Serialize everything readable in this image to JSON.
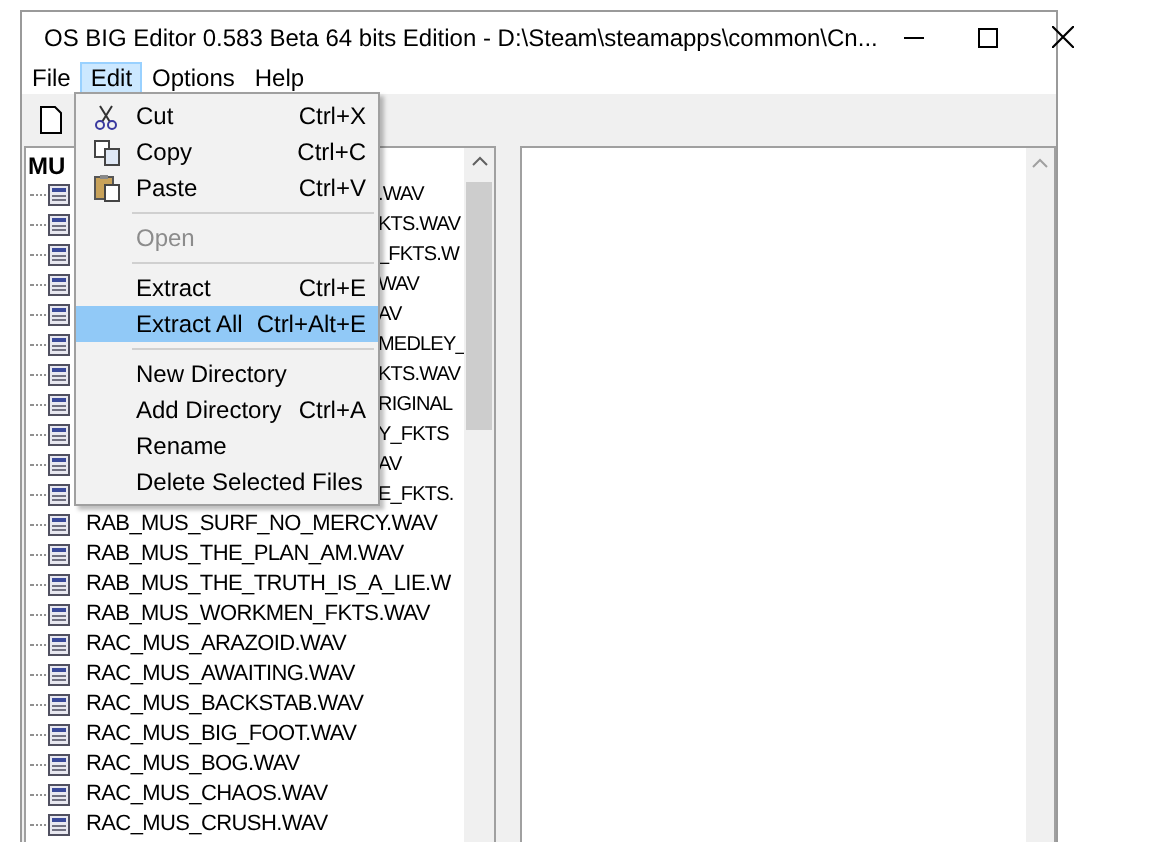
{
  "window": {
    "title": "OS BIG Editor 0.583 Beta 64 bits Edition - D:\\Steam\\steamapps\\common\\Cn..."
  },
  "menubar": [
    {
      "label": "File",
      "selected": false
    },
    {
      "label": "Edit",
      "selected": true
    },
    {
      "label": "Options",
      "selected": false
    },
    {
      "label": "Help",
      "selected": false
    }
  ],
  "edit_menu": [
    {
      "kind": "cut",
      "label": "Cut",
      "shortcut": "Ctrl+X",
      "disabled": false,
      "selected": false
    },
    {
      "kind": "copy",
      "label": "Copy",
      "shortcut": "Ctrl+C",
      "disabled": false,
      "selected": false
    },
    {
      "kind": "paste",
      "label": "Paste",
      "shortcut": "Ctrl+V",
      "disabled": false,
      "selected": false
    },
    {
      "kind": "separator"
    },
    {
      "kind": "command",
      "label": "Open",
      "disabled": true,
      "selected": false
    },
    {
      "kind": "separator"
    },
    {
      "kind": "command",
      "label": "Extract",
      "shortcut": "Ctrl+E",
      "disabled": false,
      "selected": false
    },
    {
      "kind": "command",
      "label": "Extract All",
      "shortcut": "Ctrl+Alt+E",
      "disabled": false,
      "selected": true
    },
    {
      "kind": "separator"
    },
    {
      "kind": "command",
      "label": "New Directory",
      "disabled": false,
      "selected": false
    },
    {
      "kind": "command",
      "label": "Add Directory",
      "shortcut": "Ctrl+A",
      "disabled": false,
      "selected": false
    },
    {
      "kind": "command",
      "label": "Rename",
      "disabled": false,
      "selected": false
    },
    {
      "kind": "command",
      "label": "Delete Selected Files",
      "disabled": false,
      "selected": false
    }
  ],
  "tree": {
    "root": "MU",
    "children": [
      {
        "kind": "covered",
        "label": ".WAV"
      },
      {
        "kind": "covered",
        "label": "KTS.WAV"
      },
      {
        "kind": "covered",
        "label": "_FKTS.W"
      },
      {
        "kind": "covered",
        "label": "WAV"
      },
      {
        "kind": "covered",
        "label": "AV"
      },
      {
        "kind": "covered",
        "label": "MEDLEY_"
      },
      {
        "kind": "covered",
        "label": "KTS.WAV"
      },
      {
        "kind": "covered",
        "label": "RIGINAL"
      },
      {
        "kind": "covered",
        "label": "Y_FKTS"
      },
      {
        "kind": "covered",
        "label": "AV"
      },
      {
        "kind": "covered",
        "label": "E_FKTS."
      },
      {
        "kind": "file",
        "label": "RAB_MUS_SURF_NO_MERCY.WAV"
      },
      {
        "kind": "file",
        "label": "RAB_MUS_THE_PLAN_AM.WAV"
      },
      {
        "kind": "file",
        "label": "RAB_MUS_THE_TRUTH_IS_A_LIE.W"
      },
      {
        "kind": "file",
        "label": "RAB_MUS_WORKMEN_FKTS.WAV"
      },
      {
        "kind": "file",
        "label": "RAC_MUS_ARAZOID.WAV"
      },
      {
        "kind": "file",
        "label": "RAC_MUS_AWAITING.WAV"
      },
      {
        "kind": "file",
        "label": "RAC_MUS_BACKSTAB.WAV"
      },
      {
        "kind": "file",
        "label": "RAC_MUS_BIG_FOOT.WAV"
      },
      {
        "kind": "file",
        "label": "RAC_MUS_BOG.WAV"
      },
      {
        "kind": "file",
        "label": "RAC_MUS_CHAOS.WAV"
      },
      {
        "kind": "file",
        "label": "RAC_MUS_CRUSH.WAV"
      }
    ]
  }
}
